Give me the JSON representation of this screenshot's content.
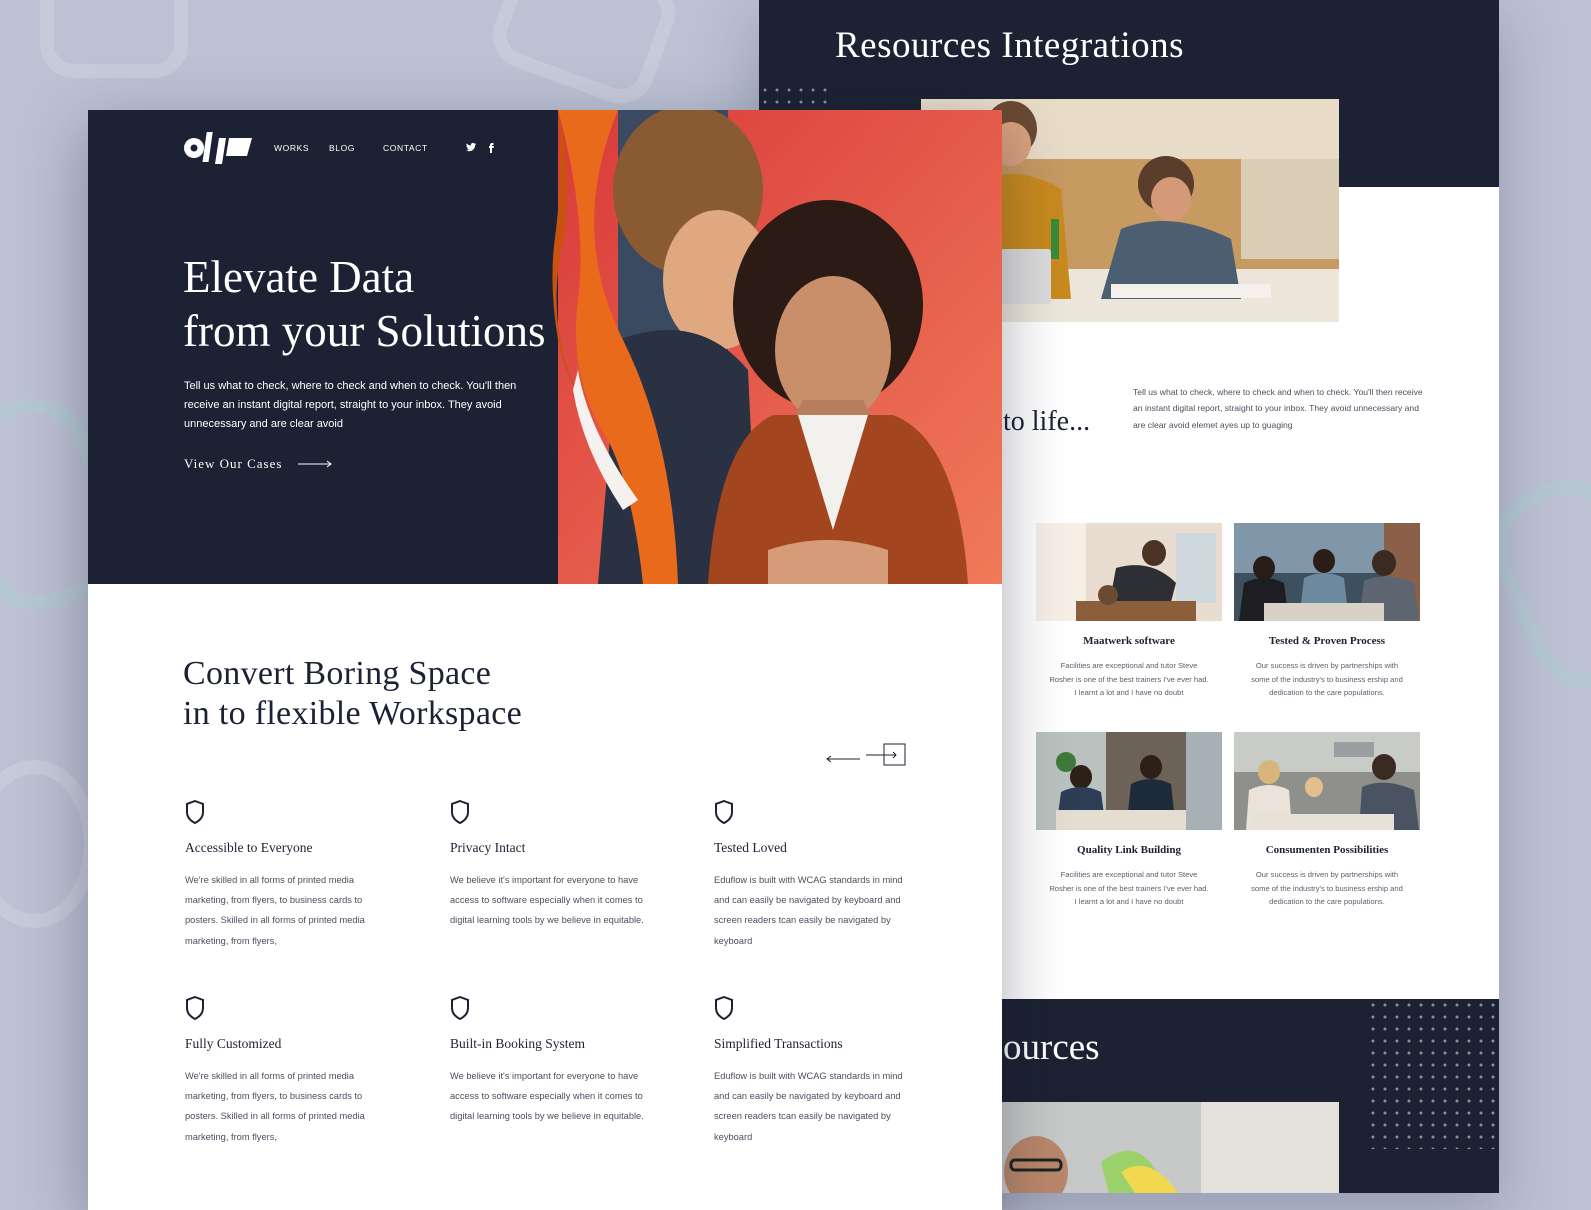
{
  "colors": {
    "navy": "#1c2233",
    "accent_orange": "#ea6a1c",
    "hero_red": "#e4473d",
    "background": "#bcc1d3"
  },
  "front": {
    "logo": {
      "icon": "olp-logo"
    },
    "nav": [
      "WORKS",
      "BLOG",
      "CONTACT"
    ],
    "social": [
      "twitter-icon",
      "facebook-icon"
    ],
    "hero": {
      "title_line1": "Elevate Data",
      "title_line2": "from your Solutions",
      "subtitle": "Tell us what to check, where to check and when to check. You'll then receive an instant digital report, straight to your inbox. They avoid unnecessary and are clear avoid",
      "cta_label": "View Our Cases"
    },
    "section": {
      "title_line1": "Convert Boring Space",
      "title_line2": "in to flexible Workspace"
    },
    "features": [
      {
        "icon": "shield-icon",
        "title": "Accessible to Everyone",
        "desc": "We're skilled in all forms of printed media marketing, from flyers, to business cards to posters. Skilled in all forms of printed media marketing, from flyers,"
      },
      {
        "icon": "shield-icon",
        "title": "Privacy Intact",
        "desc": "We believe it's important for everyone to have access to software especially when it comes to digital learning tools by we believe in equitable."
      },
      {
        "icon": "shield-icon",
        "title": "Tested Loved",
        "desc": "Eduflow is built with WCAG standards in mind and can easily be navigated by keyboard and screen readers tcan easily be navigated by keyboard"
      },
      {
        "icon": "shield-icon",
        "title": "Fully Customized",
        "desc": "We're skilled in all forms of printed media marketing, from flyers, to business cards to posters. Skilled in all forms of printed media marketing, from flyers,"
      },
      {
        "icon": "shield-icon",
        "title": "Built-in Booking System",
        "desc": "We believe it's important for everyone to have access to software especially when it comes to digital learning tools by we believe in equitable."
      },
      {
        "icon": "shield-icon",
        "title": "Simplified Transactions",
        "desc": "Eduflow is built with WCAG standards in mind and can easily be navigated by keyboard and screen readers tcan easily be navigated by keyboard"
      }
    ]
  },
  "back": {
    "header_title": "Resources Integrations",
    "tagline_fragment": "to life...",
    "intro": "Tell us what to check, where to check and when to check. You'll then receive an instant digital report, straight to your inbox. They avoid unnecessary and are clear avoid elemet ayes up to guaging",
    "cards": [
      {
        "title": "Maatwerk software",
        "desc": "Facilities are exceptional and tutor Steve Rosher is one of the best trainers I've ever had. I learnt a lot and I have no doubt"
      },
      {
        "title": "Tested & Proven Process",
        "desc": "Our success is driven by partnerships with some of the industry's to business ership and dedication to the care populations."
      },
      {
        "title": "Quality Link Building",
        "desc": "Facilities are exceptional and tutor Steve Rosher is one of the best trainers I've ever had. I learnt a lot and I have no doubt"
      },
      {
        "title": "Consumenten Possibilities",
        "desc": "Our success is driven by partnerships with some of the industry's to business ership and dedication to the care populations."
      }
    ],
    "footer_title_fragment": "ources"
  }
}
